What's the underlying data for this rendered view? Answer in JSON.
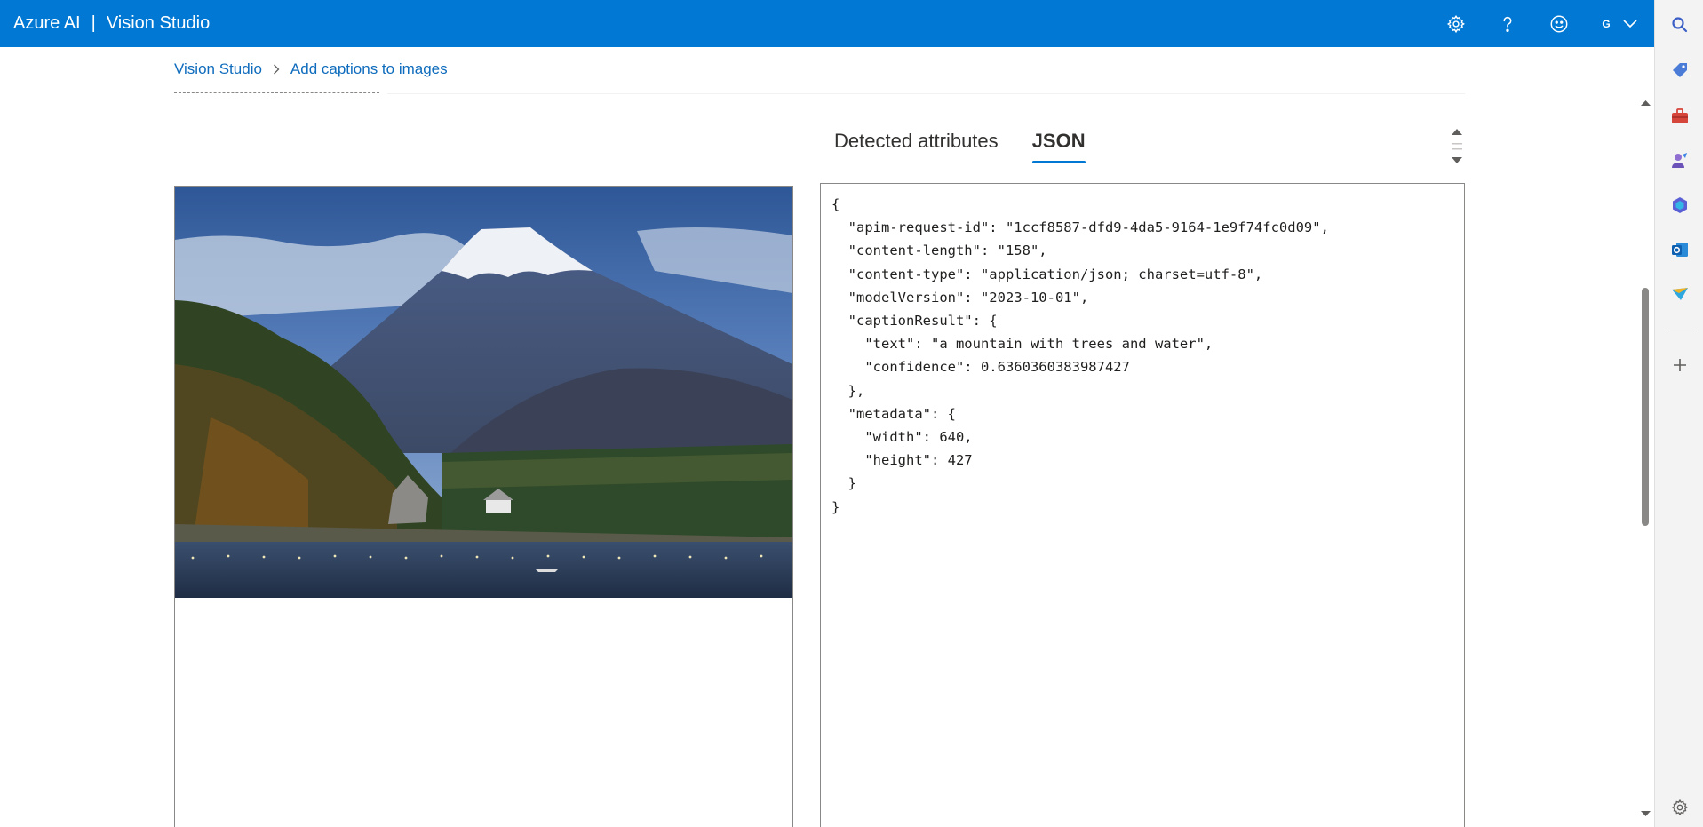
{
  "header": {
    "brand": "Azure AI",
    "separator": "|",
    "product": "Vision Studio",
    "user_initial": "G"
  },
  "breadcrumb": {
    "root": "Vision Studio",
    "current": "Add captions to images"
  },
  "tabs": [
    {
      "label": "Detected attributes",
      "active": false
    },
    {
      "label": "JSON",
      "active": true
    }
  ],
  "json_lines": [
    "{",
    "  \"apim-request-id\": \"1ccf8587-dfd9-4da5-9164-1e9f74fc0d09\",",
    "  \"content-length\": \"158\",",
    "  \"content-type\": \"application/json; charset=utf-8\",",
    "  \"modelVersion\": \"2023-10-01\",",
    "  \"captionResult\": {",
    "    \"text\": \"a mountain with trees and water\",",
    "    \"confidence\": 0.6360360383987427",
    "  },",
    "  \"metadata\": {",
    "    \"width\": 640,",
    "    \"height\": 427",
    "  }",
    "}"
  ],
  "icons": {
    "top": [
      "gear-icon",
      "help-icon",
      "smiley-icon",
      "chevron-down-icon"
    ],
    "edge": [
      "search-icon",
      "tag-icon",
      "briefcase-icon",
      "people-icon",
      "copilot-icon",
      "outlook-icon",
      "send-icon",
      "plus-icon",
      "settings-icon"
    ]
  },
  "colors": {
    "accent": "#0078d4",
    "link": "#0f6cbd"
  }
}
